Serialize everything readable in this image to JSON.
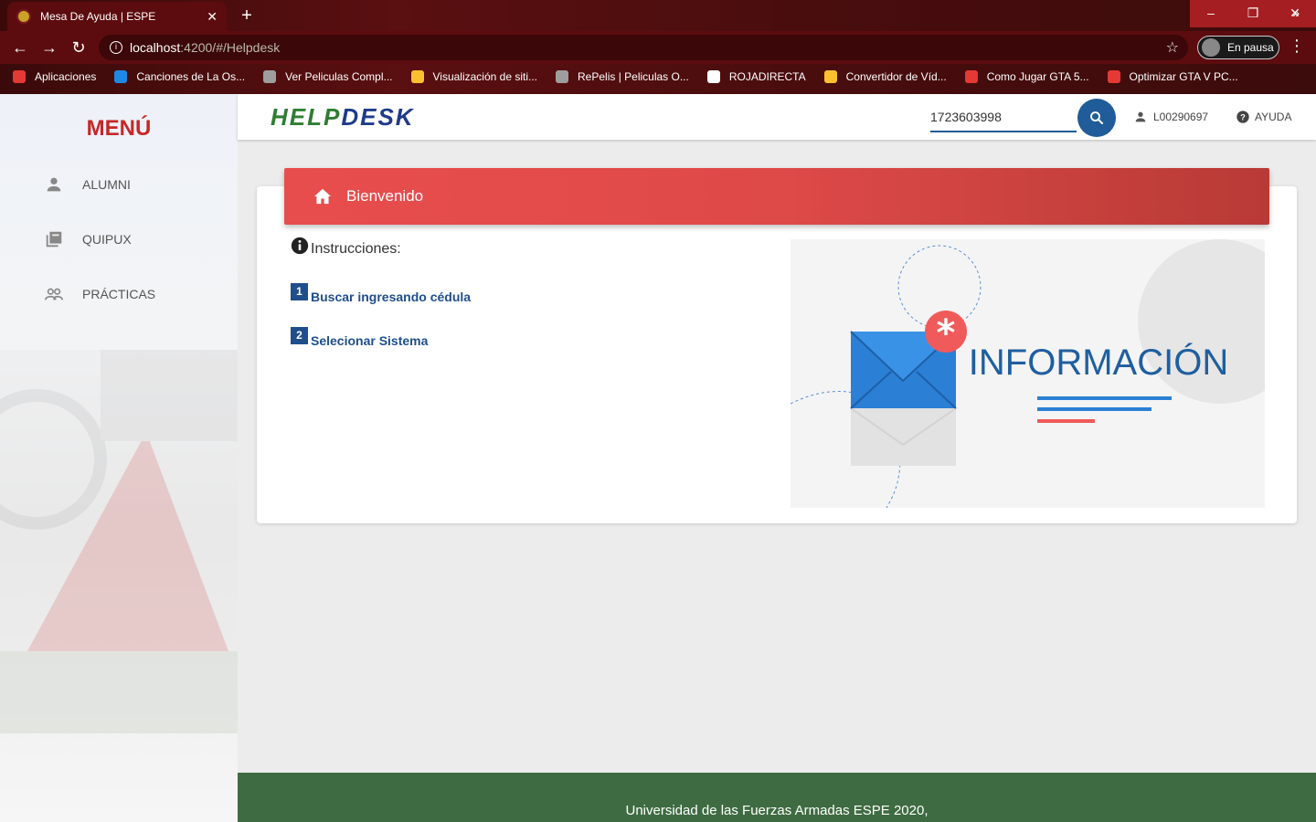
{
  "browser": {
    "tab_title": "Mesa De Ayuda | ESPE",
    "url_host": "localhost",
    "url_rest": ":4200/#/Helpdesk",
    "profile_label": "En pausa",
    "bookmarks": [
      {
        "label": "Aplicaciones",
        "color": "#e53935"
      },
      {
        "label": "Canciones de La Os...",
        "color": "#1e88e5"
      },
      {
        "label": "Ver Peliculas Compl...",
        "color": "#9e9e9e"
      },
      {
        "label": "Visualización de siti...",
        "color": "#fbc02d"
      },
      {
        "label": "RePelis | Peliculas O...",
        "color": "#9e9e9e"
      },
      {
        "label": "ROJADIRECTA",
        "color": "#ffffff"
      },
      {
        "label": "Convertidor de Víd...",
        "color": "#fbc02d"
      },
      {
        "label": "Como Jugar GTA 5...",
        "color": "#e53935"
      },
      {
        "label": "Optimizar GTA V PC...",
        "color": "#e53935"
      }
    ]
  },
  "sidebar": {
    "title": "MENÚ",
    "items": [
      {
        "label": "ALUMNI",
        "icon": "person-icon"
      },
      {
        "label": "QUIPUX",
        "icon": "library-icon"
      },
      {
        "label": "PRÁCTICAS",
        "icon": "people-icon"
      }
    ]
  },
  "header": {
    "logo_part1": "HELP",
    "logo_part2": "DESK",
    "search_value": "1723603998",
    "user": "L00290697",
    "help": "AYUDA"
  },
  "main": {
    "banner_title": "Bienvenido",
    "instructions_title": "Instrucciones:",
    "steps": [
      {
        "num": "1",
        "label": "Buscar ingresando cédula"
      },
      {
        "num": "2",
        "label": "Selecionar Sistema"
      }
    ],
    "illustration_text": "INFORMACIÓN"
  },
  "footer": {
    "text": "Universidad de las Fuerzas Armadas ESPE 2020,"
  },
  "colors": {
    "menu_title": "#c62828",
    "banner": "#e84d4d",
    "search_button": "#1f5c99",
    "footer": "#3e6b41",
    "step_blue": "#1f4e8c"
  }
}
